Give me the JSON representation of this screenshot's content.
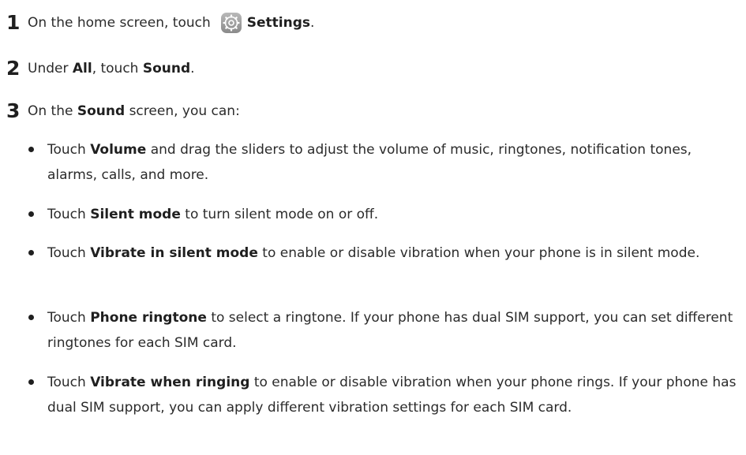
{
  "steps": [
    {
      "number": "1",
      "parts": [
        "On the home screen, touch ",
        "Settings",
        "."
      ],
      "icon": "settings-gear-icon",
      "icon_color": "#9a9a9a"
    },
    {
      "number": "2",
      "parts": [
        "Under ",
        "All",
        ", touch ",
        "Sound",
        "."
      ]
    },
    {
      "number": "3",
      "parts": [
        "On the ",
        "Sound",
        " screen, you can:"
      ]
    }
  ],
  "bullets": [
    {
      "pre": "Touch ",
      "bold": "Volume",
      "post": " and drag the sliders to adjust the volume of music, ringtones, notification tones, alarms, calls, and more."
    },
    {
      "pre": "Touch ",
      "bold": "Silent mode",
      "post": " to turn silent mode on or off."
    },
    {
      "pre": "Touch ",
      "bold": "Vibrate in silent mode",
      "post": " to enable or disable vibration when your phone is in silent mode."
    },
    {
      "pre": "Touch ",
      "bold": "Phone ringtone",
      "post": " to select a ringtone. If your phone has dual SIM support, you can set different ringtones for each SIM card."
    },
    {
      "pre": "Touch ",
      "bold": "Vibrate when ringing",
      "post": " to enable or disable vibration when your phone rings. If your phone has dual SIM support, you can apply different vibration settings for each SIM card."
    }
  ]
}
